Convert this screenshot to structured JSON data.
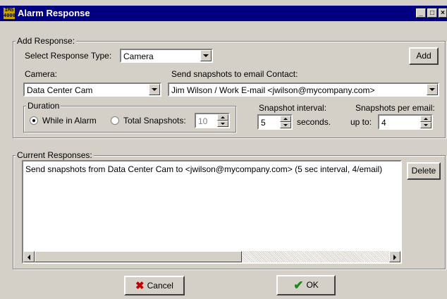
{
  "window": {
    "title": "Alarm Response",
    "app_icon_text": "IMS 4000",
    "minimize_label": "_",
    "maximize_label": "□",
    "close_label": "×"
  },
  "add_response": {
    "group_label": "Add Response:",
    "response_type_label": "Select Response Type:",
    "response_type_value": "Camera",
    "add_button": "Add",
    "camera_label": "Camera:",
    "camera_value": "Data Center Cam",
    "email_label": "Send snapshots to email Contact:",
    "email_value": "Jim Wilson / Work E-mail <jwilson@mycompany.com>",
    "duration": {
      "group_label": "Duration",
      "option_while_alarm": "While in Alarm",
      "option_total": "Total Snapshots:",
      "selected": "While in Alarm",
      "total_value": "10"
    },
    "interval_label": "Snapshot interval:",
    "interval_value": "5",
    "interval_unit": "seconds.",
    "per_email_label": "Snapshots per email:",
    "per_email_prefix": "up to:",
    "per_email_value": "4"
  },
  "current_responses": {
    "group_label": "Current Responses:",
    "items": [
      "Send snapshots from Data Center Cam to <jwilson@mycompany.com> (5 sec interval, 4/email)"
    ],
    "delete_button": "Delete"
  },
  "footer": {
    "cancel_button": "Cancel",
    "ok_button": "OK"
  }
}
